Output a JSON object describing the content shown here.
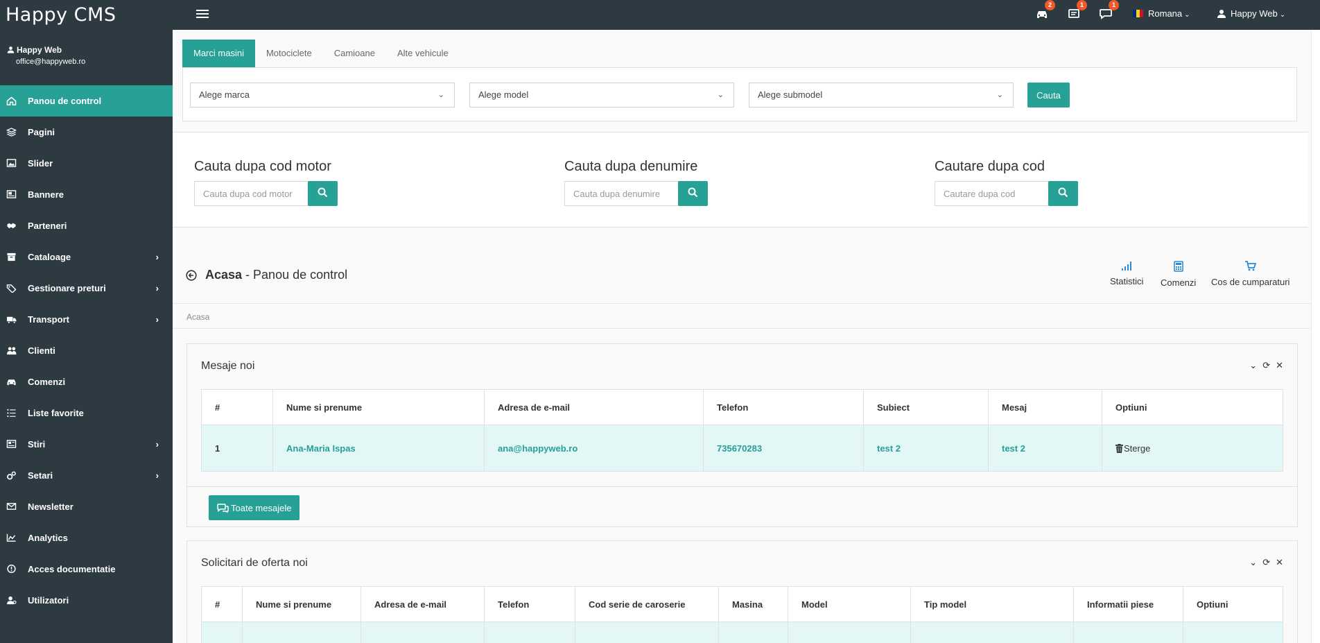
{
  "app": {
    "logo": "Happy CMS"
  },
  "topbar": {
    "notifications": [
      {
        "icon": "car-icon",
        "count": "2"
      },
      {
        "icon": "offer-icon",
        "count": "1"
      },
      {
        "icon": "chat-icon",
        "count": "1"
      }
    ],
    "language": "Romana",
    "user": "Happy Web"
  },
  "sidebar": {
    "user_name": "Happy Web",
    "user_email": "office@happyweb.ro",
    "items": [
      {
        "label": "Panou de control",
        "icon": "home-icon",
        "active": true
      },
      {
        "label": "Pagini",
        "icon": "layers-icon"
      },
      {
        "label": "Slider",
        "icon": "image-icon"
      },
      {
        "label": "Bannere",
        "icon": "banner-icon"
      },
      {
        "label": "Parteneri",
        "icon": "handshake-icon"
      },
      {
        "label": "Cataloage",
        "icon": "archive-icon",
        "submenu": true
      },
      {
        "label": "Gestionare preturi",
        "icon": "tags-icon",
        "submenu": true
      },
      {
        "label": "Transport",
        "icon": "truck-icon",
        "submenu": true
      },
      {
        "label": "Clienti",
        "icon": "users-icon"
      },
      {
        "label": "Comenzi",
        "icon": "car-icon"
      },
      {
        "label": "Liste favorite",
        "icon": "list-icon"
      },
      {
        "label": "Stiri",
        "icon": "newspaper-icon",
        "submenu": true
      },
      {
        "label": "Setari",
        "icon": "settings-icon",
        "submenu": true
      },
      {
        "label": "Newsletter",
        "icon": "envelope-icon"
      },
      {
        "label": "Analytics",
        "icon": "chart-icon"
      },
      {
        "label": "Acces documentatie",
        "icon": "info-icon"
      },
      {
        "label": "Utilizatori",
        "icon": "user-cog-icon"
      }
    ]
  },
  "vehicle_search": {
    "tabs": [
      "Marci masini",
      "Motociclete",
      "Camioane",
      "Alte vehicule"
    ],
    "active_tab": "Marci masini",
    "selects": [
      "Alege marca",
      "Alege model",
      "Alege submodel"
    ],
    "button": "Cauta"
  },
  "quick_search": [
    {
      "title": "Cauta dupa cod motor",
      "placeholder": "Cauta dupa cod motor"
    },
    {
      "title": "Cauta dupa denumire",
      "placeholder": "Cauta dupa denumire"
    },
    {
      "title": "Cautare dupa cod",
      "placeholder": "Cautare dupa cod"
    }
  ],
  "page": {
    "title_bold": "Acasa",
    "title_rest": " - Panou de control",
    "quick_links": [
      {
        "label": "Statistici",
        "icon": "signal-icon"
      },
      {
        "label": "Comenzi",
        "icon": "calculator-icon"
      },
      {
        "label": "Cos de cumparaturi",
        "icon": "cart-icon"
      }
    ],
    "breadcrumb": "Acasa"
  },
  "messages_panel": {
    "title": "Mesaje noi",
    "columns": [
      "#",
      "Nume si prenume",
      "Adresa de e-mail",
      "Telefon",
      "Subiect",
      "Mesaj",
      "Optiuni"
    ],
    "rows": [
      {
        "num": "1",
        "name": "Ana-Maria Ispas",
        "email": "ana@happyweb.ro",
        "phone": "735670283",
        "subject": "test 2",
        "message": "test 2",
        "action": "Sterge"
      }
    ],
    "all_button": "Toate mesajele"
  },
  "offers_panel": {
    "title": "Solicitari de oferta noi",
    "columns": [
      "#",
      "Nume si prenume",
      "Adresa de e-mail",
      "Telefon",
      "Cod serie de caroserie",
      "Masina",
      "Model",
      "Tip model",
      "Informatii piese",
      "Optiuni"
    ]
  },
  "colors": {
    "accent": "#27a096",
    "dark": "#2e3a42",
    "row_highlight": "#e2f7f6",
    "badge": "#f05a28"
  }
}
